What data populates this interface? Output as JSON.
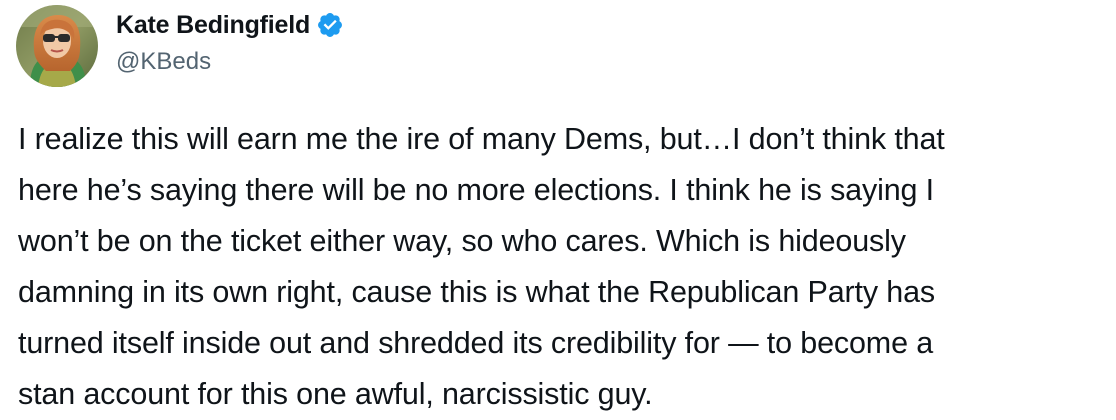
{
  "author": {
    "display_name": "Kate Bedingfield",
    "handle": "@KBeds",
    "verified": true,
    "verified_color": "#1d9bf0",
    "avatar_icon": "profile-photo"
  },
  "tweet": {
    "lines": [
      "I realize this will earn me the ire of many Dems, but…I don’t think that",
      "here he’s saying there will be no more elections. I think he is saying I",
      "won’t be on the ticket either way, so who cares. Which is hideously",
      "damning in its own right, cause this is what the Republican Party has",
      "turned itself inside out and shredded its credibility for — to become a",
      "stan account for this one awful, narcissistic guy."
    ]
  }
}
